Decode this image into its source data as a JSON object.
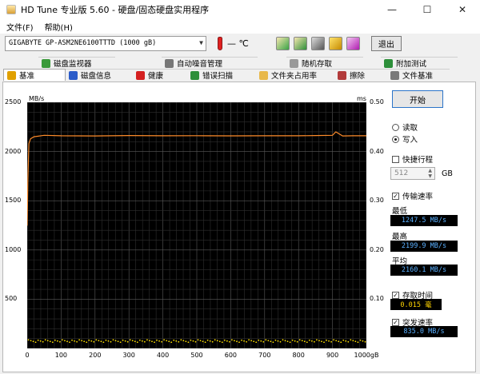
{
  "window": {
    "title": "HD Tune 专业版 5.60 - 硬盘/固态硬盘实用程序",
    "minimize": "—",
    "maximize": "☐",
    "close": "✕"
  },
  "menu": {
    "file": "文件(F)",
    "help": "帮助(H)"
  },
  "toolbar": {
    "drive": "GIGABYTE GP-ASM2NE6100TTTD (1000 gB)",
    "temperature": "— ℃",
    "exit_label": "退出"
  },
  "tabs_top": [
    "磁盘监视器",
    "自动噪音管理",
    "随机存取",
    "附加测试"
  ],
  "tabs_bottom": [
    "基准",
    "磁盘信息",
    "健康",
    "错误扫描",
    "文件夹占用率",
    "擦除",
    "文件基准"
  ],
  "chart_data": {
    "type": "line",
    "yunit_left": "MB/s",
    "yunit_right": "ms",
    "y_ticks_left": [
      "2500",
      "2000",
      "1500",
      "1000",
      "500"
    ],
    "y_ticks_right": [
      "0.50",
      "0.40",
      "0.30",
      "0.20",
      "0.10"
    ],
    "x_ticks": [
      "0",
      "100",
      "200",
      "300",
      "400",
      "500",
      "600",
      "700",
      "800",
      "900",
      "1000gB"
    ],
    "xlim": [
      0,
      1000
    ],
    "ylim": [
      0,
      2500
    ],
    "y2lim": [
      0,
      0.5
    ],
    "grid": true,
    "series": [
      {
        "role": "transfer",
        "color": "#ff8c2a",
        "x": [
          0,
          2,
          5,
          10,
          20,
          50,
          100,
          200,
          300,
          400,
          500,
          600,
          700,
          800,
          850,
          900,
          910,
          930,
          960,
          1000
        ],
        "y": [
          1247,
          1700,
          2080,
          2130,
          2150,
          2165,
          2160,
          2158,
          2162,
          2160,
          2161,
          2159,
          2160,
          2160,
          2162,
          2165,
          2200,
          2158,
          2160,
          2160
        ]
      },
      {
        "role": "access",
        "color": "#ffe000",
        "value_ms": 0.015
      }
    ]
  },
  "side": {
    "start_label": "开始",
    "read_label": "读取",
    "write_label": "写入",
    "selected_mode": "write",
    "quick_label": "快捷行程",
    "quick_value": "512",
    "quick_unit": "GB",
    "transfer_label": "传输速率",
    "min_label": "最低",
    "min_value": "1247.5 MB/s",
    "max_label": "最高",
    "max_value": "2199.9 MB/s",
    "avg_label": "平均",
    "avg_value": "2160.1 MB/s",
    "access_label": "存取时间",
    "access_value": "0.015 毫",
    "burst_label": "突发速率",
    "burst_value": "835.0 MB/s"
  },
  "colors": {
    "plot_bg": "#000000",
    "grid": "#5a5a5a",
    "transfer_line": "#ff8c2a",
    "access_dots": "#ffe000",
    "readout_text": "#5ab0ff"
  }
}
